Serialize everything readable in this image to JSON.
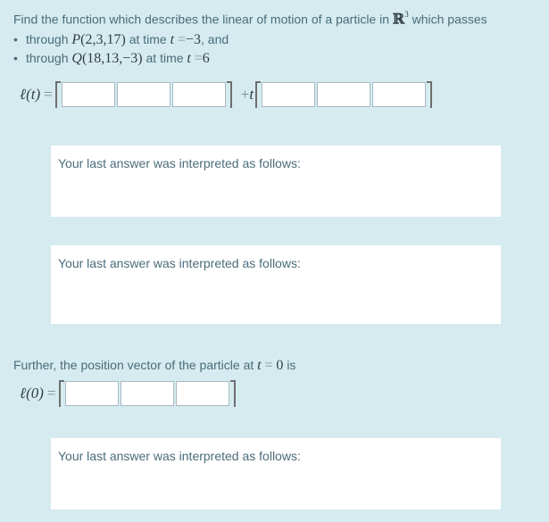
{
  "prompt": {
    "prefix": "Find the function which describes the linear of motion of a particle in",
    "space_symbol": "ℝ",
    "space_exponent": "3",
    "suffix": "which passes"
  },
  "conditions": [
    {
      "through": "through",
      "point_name": "P",
      "point_coords": "(2,3,17)",
      "at_time": "at time",
      "t_var": "t",
      "equals": "=",
      "time_value": "−3",
      "trailing": ", and"
    },
    {
      "through": "through",
      "point_name": "Q",
      "point_coords": "(18,13,−3)",
      "at_time": "at time",
      "t_var": "t",
      "equals": "=",
      "time_value": "6",
      "trailing": ""
    }
  ],
  "line_equation": {
    "lhs": "ℓ(t)",
    "equals": "=",
    "plus_sign": "+",
    "t_var": "t",
    "point_inputs": [
      "",
      "",
      ""
    ],
    "direction_inputs": [
      "",
      "",
      ""
    ]
  },
  "interpreted_label_1": "Your last answer was interpreted as follows:",
  "interpreted_label_2": "Your last answer was interpreted as follows:",
  "further": {
    "prefix": "Further, the position vector of the particle at",
    "t_var": "t",
    "equals": "=",
    "value": "0",
    "suffix": "is"
  },
  "position_equation": {
    "lhs": "ℓ(0)",
    "equals": "=",
    "inputs": [
      "",
      "",
      ""
    ]
  },
  "interpreted_label_3": "Your last answer was interpreted as follows:",
  "colors": {
    "background": "#d5ebef",
    "text": "#4a6c7a",
    "panel": "#ffffff"
  }
}
